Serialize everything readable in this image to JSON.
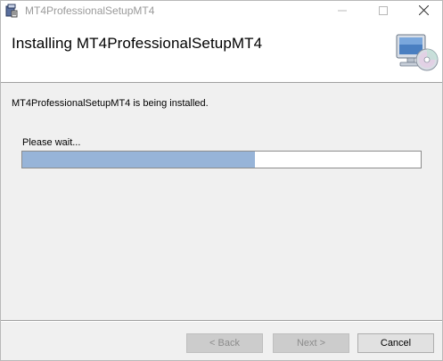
{
  "window": {
    "title": "MT4ProfessionalSetupMT4",
    "controls": {
      "minimize_icon": "minimize-icon",
      "maximize_icon": "maximize-icon",
      "close_icon": "close-icon"
    }
  },
  "banner": {
    "title": "Installing MT4ProfessionalSetupMT4",
    "icon": "computer-cd-icon"
  },
  "body": {
    "status": "MT4ProfessionalSetupMT4 is being installed.",
    "wait_label": "Please wait...",
    "progress_fraction": 0.584
  },
  "footer": {
    "back_label": "< Back",
    "next_label": "Next >",
    "cancel_label": "Cancel",
    "back_enabled": false,
    "next_enabled": false,
    "cancel_enabled": true
  },
  "colors": {
    "progress_fill": "#97b4d8",
    "window_bg": "#f0f0f0"
  }
}
